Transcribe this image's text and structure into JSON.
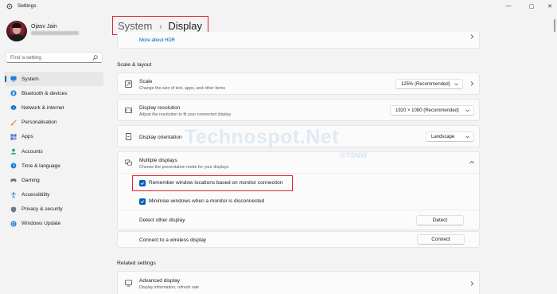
{
  "window": {
    "title": "Settings",
    "controls": {
      "minimize": "—",
      "maximize": "▢",
      "close": "✕"
    }
  },
  "profile": {
    "name": "Ojasv Jain"
  },
  "search": {
    "placeholder": "Find a setting"
  },
  "sidebar": {
    "items": [
      {
        "label": "System",
        "icon": "system-icon",
        "active": true
      },
      {
        "label": "Bluetooth & devices",
        "icon": "bluetooth-icon"
      },
      {
        "label": "Network & internet",
        "icon": "network-icon"
      },
      {
        "label": "Personalisation",
        "icon": "personalisation-icon"
      },
      {
        "label": "Apps",
        "icon": "apps-icon"
      },
      {
        "label": "Accounts",
        "icon": "accounts-icon"
      },
      {
        "label": "Time & language",
        "icon": "time-language-icon"
      },
      {
        "label": "Gaming",
        "icon": "gaming-icon"
      },
      {
        "label": "Accessibility",
        "icon": "accessibility-icon"
      },
      {
        "label": "Privacy & security",
        "icon": "privacy-icon"
      },
      {
        "label": "Windows Update",
        "icon": "windows-update-icon"
      }
    ]
  },
  "header": {
    "crumb": "System",
    "separator": "›",
    "current": "Display"
  },
  "main": {
    "hdr_link": "More about HDR",
    "scale_layout_title": "Scale & layout",
    "scale": {
      "title": "Scale",
      "subtitle": "Change the size of text, apps, and other items",
      "value": "125% (Recommended)"
    },
    "resolution": {
      "title": "Display resolution",
      "subtitle": "Adjust the resolution to fit your connected display",
      "value": "1920 × 1080 (Recommended)"
    },
    "orientation": {
      "title": "Display orientation",
      "value": "Landscape"
    },
    "multiple_displays": {
      "title": "Multiple displays",
      "subtitle": "Choose the presentation mode for your displays",
      "remember_label": "Remember window locations based on monitor connection",
      "remember_checked": true,
      "minimise_label": "Minimise windows when a monitor is disconnected",
      "minimise_checked": true,
      "detect_label": "Detect other display",
      "detect_button": "Detect",
      "connect_label": "Connect to a wireless display",
      "connect_button": "Connect"
    },
    "related_title": "Related settings",
    "advanced": {
      "title": "Advanced display",
      "subtitle": "Display information, refresh rate"
    }
  },
  "watermark": {
    "text": "Technospot.Net",
    "sub": "@TSNW"
  },
  "colors": {
    "accent": "#005fb8",
    "highlight": "#e02430",
    "background": "#f3f3f3",
    "card": "#fbfbfb"
  }
}
